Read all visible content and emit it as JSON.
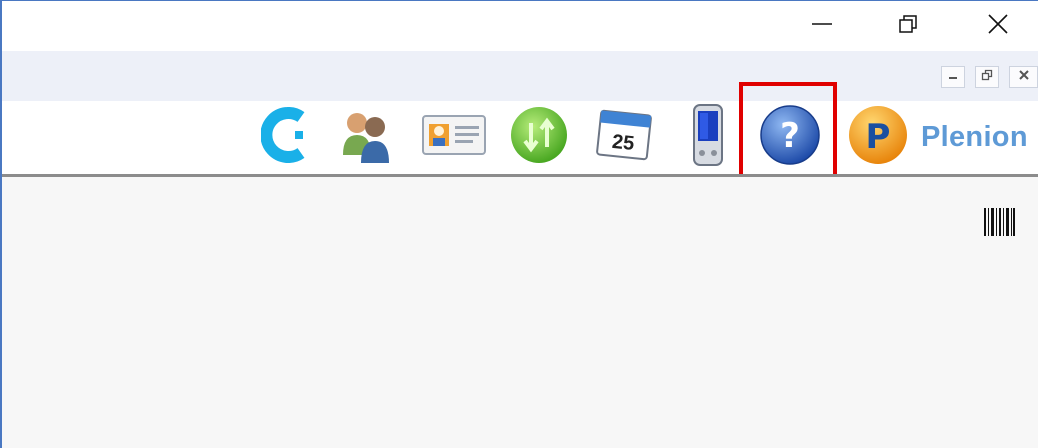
{
  "window": {
    "controls": [
      {
        "name": "minimize",
        "icon": "minimize-icon"
      },
      {
        "name": "restore",
        "icon": "restore-icon"
      },
      {
        "name": "close",
        "icon": "close-icon"
      }
    ]
  },
  "mdi": {
    "controls": [
      {
        "name": "mdi-minimize",
        "icon": "minimize-icon"
      },
      {
        "name": "mdi-restore",
        "icon": "restore-icon"
      },
      {
        "name": "mdi-close",
        "icon": "close-icon"
      }
    ]
  },
  "toolbar": {
    "icons": [
      {
        "name": "connect",
        "icon": "c-logo-icon",
        "color": "#1ab0e8"
      },
      {
        "name": "contacts",
        "icon": "people-icon"
      },
      {
        "name": "id-card",
        "icon": "id-card-icon"
      },
      {
        "name": "sync",
        "icon": "sync-arrows-icon",
        "color": "#5cc02e"
      },
      {
        "name": "calendar",
        "icon": "calendar-icon",
        "day": "25"
      },
      {
        "name": "mobile",
        "icon": "pda-device-icon"
      },
      {
        "name": "help",
        "icon": "question-mark-icon",
        "highlighted": true,
        "color": "#2f6fd0"
      }
    ],
    "brand": {
      "letter": "P",
      "text": "Plenion",
      "color": "#5e9ad6",
      "badge_color": "#f39a1a"
    }
  },
  "highlight_color": "#e00000",
  "content": {
    "barcode_icon": "barcode-icon"
  }
}
